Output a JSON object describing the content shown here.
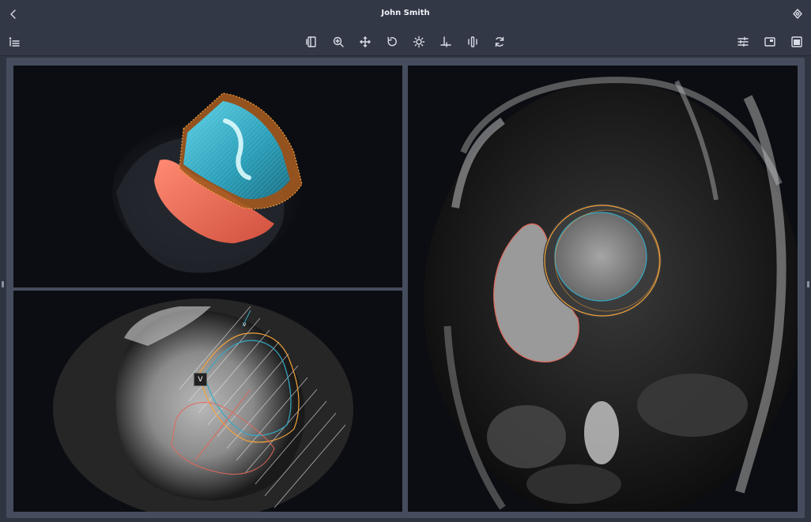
{
  "window": {
    "title": "John Smith"
  },
  "toolbar": {
    "left": [
      {
        "name": "info-list-icon"
      }
    ],
    "center": [
      {
        "name": "layout-icon"
      },
      {
        "name": "zoom-icon"
      },
      {
        "name": "pan-icon"
      },
      {
        "name": "rotate-icon"
      },
      {
        "name": "brightness-icon"
      },
      {
        "name": "crosshair-icon"
      },
      {
        "name": "slice-icon"
      },
      {
        "name": "sync-icon"
      }
    ],
    "right": [
      {
        "name": "settings-sliders-icon"
      },
      {
        "name": "window-icon"
      },
      {
        "name": "panel-icon"
      }
    ]
  },
  "viewports": {
    "four_chamber": {
      "marker_label": "V",
      "marker_label_top": "v"
    }
  },
  "colors": {
    "background": "#2f3441",
    "toolbar": "#333847",
    "viewport_bg": "#0b0d12",
    "lv_endo": "#35a8c2",
    "lv_epi": "#f2a23a",
    "rv": "#e0685a"
  }
}
